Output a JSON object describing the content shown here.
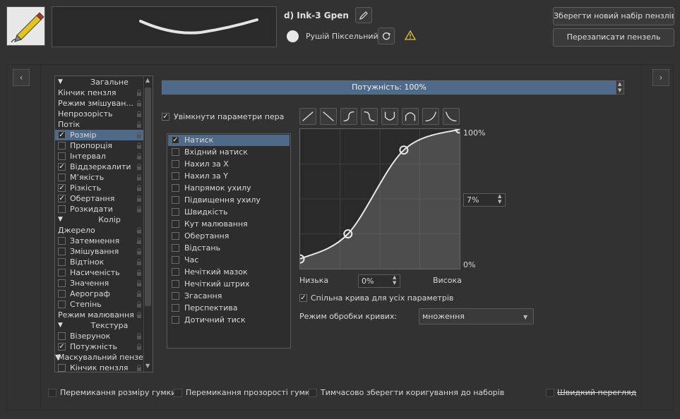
{
  "preset": {
    "name": "d) Ink-3 Gpen",
    "engine": "Рушій Піксельний",
    "save_new": "Зберегти новий набір пензлів...",
    "overwrite": "Перезаписати пензель"
  },
  "options": [
    {
      "label": "Загальне",
      "kind": "header"
    },
    {
      "label": "Кінчик пензля",
      "kind": "plain"
    },
    {
      "label": "Режим змішуван...",
      "kind": "plain"
    },
    {
      "label": "Непрозорість",
      "kind": "plain"
    },
    {
      "label": "Потік",
      "kind": "plain"
    },
    {
      "label": "Розмір",
      "kind": "check",
      "checked": true,
      "selected": true
    },
    {
      "label": "Пропорція",
      "kind": "check",
      "checked": false
    },
    {
      "label": "Інтервал",
      "kind": "check",
      "checked": false
    },
    {
      "label": "Віддзеркалити",
      "kind": "check",
      "checked": true
    },
    {
      "label": "М’якість",
      "kind": "check",
      "checked": false
    },
    {
      "label": "Різкість",
      "kind": "check",
      "checked": true
    },
    {
      "label": "Обертання",
      "kind": "check",
      "checked": true
    },
    {
      "label": "Розкидати",
      "kind": "check",
      "checked": false
    },
    {
      "label": "Колір",
      "kind": "header"
    },
    {
      "label": "Джерело",
      "kind": "plain"
    },
    {
      "label": "Затемнення",
      "kind": "check",
      "checked": false
    },
    {
      "label": "Змішування",
      "kind": "check",
      "checked": false
    },
    {
      "label": "Відтінок",
      "kind": "check",
      "checked": false
    },
    {
      "label": "Насиченість",
      "kind": "check",
      "checked": false
    },
    {
      "label": "Значення",
      "kind": "check",
      "checked": false
    },
    {
      "label": "Аерограф",
      "kind": "check",
      "checked": false
    },
    {
      "label": "Степінь",
      "kind": "check",
      "checked": false
    },
    {
      "label": "Режим малювання",
      "kind": "plain"
    },
    {
      "label": "Текстура",
      "kind": "header"
    },
    {
      "label": "Візерунок",
      "kind": "check",
      "checked": false
    },
    {
      "label": "Потужність",
      "kind": "check",
      "checked": true
    },
    {
      "label": "Маскувальний пензель",
      "kind": "header2"
    },
    {
      "label": "Кінчик пензля",
      "kind": "check",
      "checked": false
    }
  ],
  "strength": {
    "label": "Потужність: 100%",
    "value": 1.0
  },
  "enable_pen": {
    "label": "Увімкнути параметри пера",
    "checked": true
  },
  "sensors": [
    {
      "label": "Натиск",
      "checked": true,
      "selected": true
    },
    {
      "label": "Вхідний натиск",
      "checked": false
    },
    {
      "label": "Нахил за X",
      "checked": false
    },
    {
      "label": "Нахил за Y",
      "checked": false
    },
    {
      "label": "Напрямок ухилу",
      "checked": false
    },
    {
      "label": "Підвищення ухилу",
      "checked": false
    },
    {
      "label": "Швидкість",
      "checked": false
    },
    {
      "label": "Кут малювання",
      "checked": false
    },
    {
      "label": "Обертання",
      "checked": false
    },
    {
      "label": "Відстань",
      "checked": false
    },
    {
      "label": "Час",
      "checked": false
    },
    {
      "label": "Нечіткий мазок",
      "checked": false
    },
    {
      "label": "Нечіткий штрих",
      "checked": false
    },
    {
      "label": "Згасання",
      "checked": false
    },
    {
      "label": "Перспектива",
      "checked": false
    },
    {
      "label": "Дотичний тиск",
      "checked": false
    }
  ],
  "curve": {
    "max_label": "100%",
    "min_label": "0%",
    "value": "7%",
    "x_value": "0%",
    "low_label": "Низька",
    "high_label": "Висока",
    "points": [
      [
        0,
        0.07
      ],
      [
        0.3,
        0.25
      ],
      [
        0.65,
        0.85
      ],
      [
        1,
        1
      ]
    ],
    "presets": [
      "linear-rising-icon",
      "linear-falling-icon",
      "s-curve-icon",
      "reverse-s-curve-icon",
      "u-curve-icon",
      "arch-curve-icon",
      "j-curve-icon",
      "reverse-j-curve-icon"
    ]
  },
  "shared_curve": {
    "label": "Спільна крива для усіх параметрів",
    "checked": true
  },
  "curve_mode": {
    "label": "Режим обробки кривих:",
    "value": "множення"
  },
  "bottom": {
    "eraser_size": "Перемикання розміру гумки",
    "eraser_opacity": "Перемикання прозорості гумки",
    "temp_save": "Тимчасово зберегти коригування до наборів",
    "quick_preview": "Швидкий перегляд"
  },
  "colors": {
    "accent": "#4f6a89",
    "background": "#323232"
  }
}
